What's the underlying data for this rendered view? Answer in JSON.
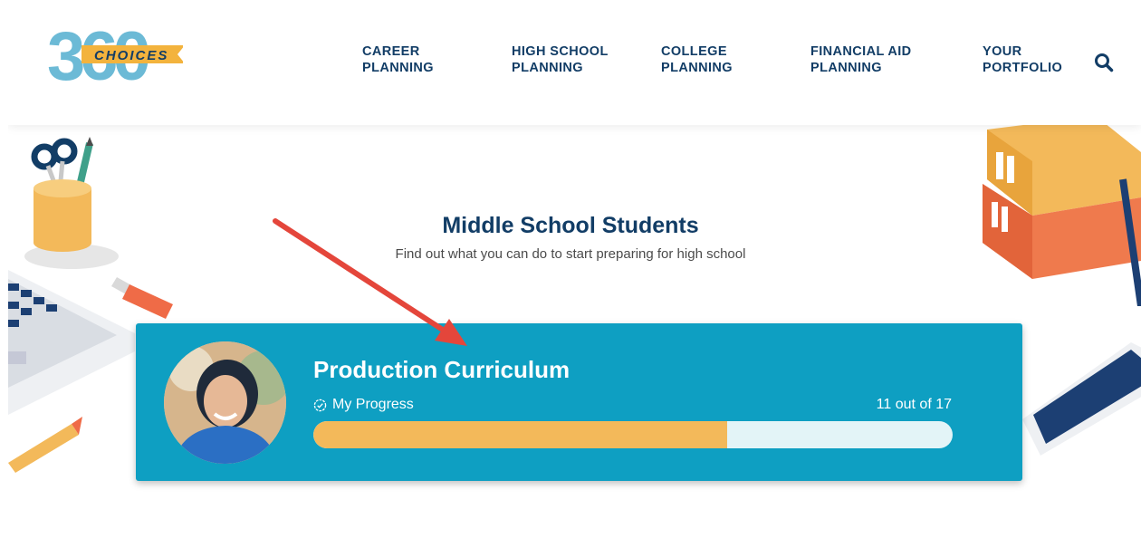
{
  "logo": {
    "number": "360",
    "word": "CHOICES"
  },
  "nav": [
    {
      "line1": "CAREER",
      "line2": "PLANNING"
    },
    {
      "line1": "HIGH SCHOOL",
      "line2": "PLANNING"
    },
    {
      "line1": "COLLEGE",
      "line2": "PLANNING"
    },
    {
      "line1": "FINANCIAL AID",
      "line2": "PLANNING"
    },
    {
      "line1": "YOUR",
      "line2": "PORTFOLIO"
    }
  ],
  "icons": {
    "search": "search-icon",
    "progress": "check-circle-icon"
  },
  "hero": {
    "title": "Middle School Students",
    "subtitle": "Find out what you can do to start preparing for high school"
  },
  "card": {
    "title": "Production Curriculum",
    "progress_label": "My Progress",
    "progress_text": "11 out of 17",
    "progress_completed": 11,
    "progress_total": 17
  },
  "colors": {
    "navy": "#123d66",
    "card": "#0e9fc2",
    "progress_fill": "#f3b95a",
    "progress_track": "#e3f4f7",
    "arrow": "#e4463b"
  }
}
